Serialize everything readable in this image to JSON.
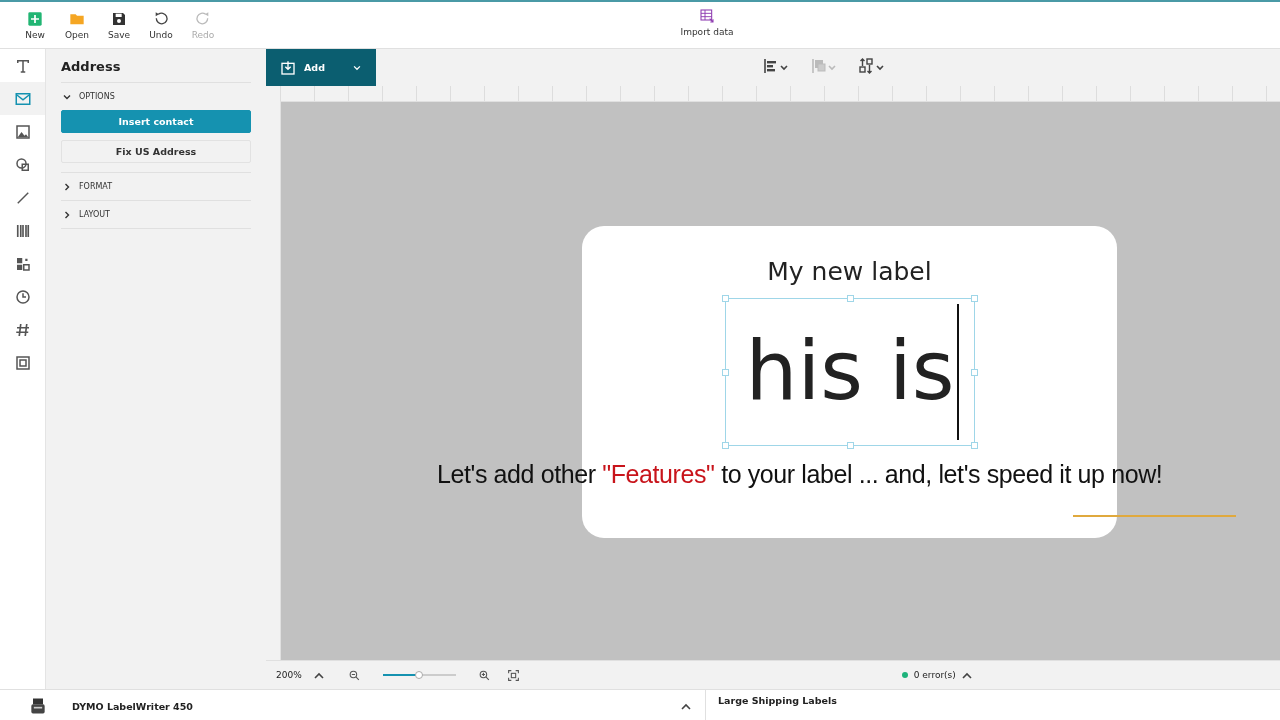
{
  "toolbar": {
    "buttons": [
      {
        "label": "New",
        "kind": "new",
        "disabled": false
      },
      {
        "label": "Open",
        "kind": "open",
        "disabled": false
      },
      {
        "label": "Save",
        "kind": "save",
        "disabled": false
      },
      {
        "label": "Undo",
        "kind": "undo",
        "disabled": false
      },
      {
        "label": "Redo",
        "kind": "redo",
        "disabled": true
      }
    ],
    "import": {
      "label": "Import data"
    }
  },
  "tool_rail": [
    {
      "kind": "text",
      "selected": false
    },
    {
      "kind": "address",
      "selected": true
    },
    {
      "kind": "image",
      "selected": false
    },
    {
      "kind": "shapes",
      "selected": false
    },
    {
      "kind": "line",
      "selected": false
    },
    {
      "kind": "barcode",
      "selected": false
    },
    {
      "kind": "qrcode",
      "selected": false
    },
    {
      "kind": "datetime",
      "selected": false
    },
    {
      "kind": "counter",
      "selected": false
    },
    {
      "kind": "container",
      "selected": false
    }
  ],
  "panel": {
    "title": "Address",
    "sections": [
      {
        "label": "OPTIONS",
        "expanded": true,
        "buttons": [
          {
            "label": "Insert contact",
            "kind": "primary"
          },
          {
            "label": "Fix US Address",
            "kind": "secondary"
          }
        ]
      },
      {
        "label": "FORMAT",
        "expanded": false
      },
      {
        "label": "LAYOUT",
        "expanded": false
      }
    ]
  },
  "canvas": {
    "add_button": {
      "label": "Add"
    },
    "tools": [
      {
        "kind": "align",
        "disabled": false
      },
      {
        "kind": "arrange",
        "disabled": true
      },
      {
        "kind": "distribute",
        "disabled": false
      }
    ],
    "label": {
      "title": "My new label",
      "text": "his is"
    },
    "caption": "Let's add other *\"Features\"* to your label ... and, let's speed it up now!"
  },
  "zoom": {
    "value": "200%",
    "level": 0.49
  },
  "errors": {
    "label": "0 error(s)"
  },
  "status_bar": {
    "printer": "DYMO LabelWriter 450",
    "label_type": "Large Shipping Labels"
  }
}
